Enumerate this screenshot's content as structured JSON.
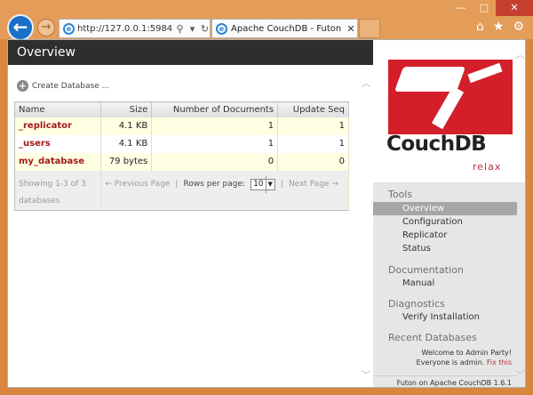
{
  "browser": {
    "address_text": "http://127.0.0.1:5984/_u",
    "tab_title": "Apache CouchDB - Futon: ...",
    "search_icon": "search-icon",
    "refresh_icon": "refresh-icon"
  },
  "page": {
    "header_title": "Overview",
    "create_db_label": "Create Database ...",
    "table": {
      "columns": [
        "Name",
        "Size",
        "Number of Documents",
        "Update Seq"
      ],
      "rows": [
        {
          "name": "_replicator",
          "size": "4.1 KB",
          "docs": "1",
          "seq": "1"
        },
        {
          "name": "_users",
          "size": "4.1 KB",
          "docs": "1",
          "seq": "1"
        },
        {
          "name": "my_database",
          "size": "79 bytes",
          "docs": "0",
          "seq": "0"
        }
      ],
      "footer": {
        "showing": "Showing 1-3 of 3 databases",
        "prev": "← Previous Page",
        "sep1": "|",
        "rows_label": "Rows per page:",
        "rows_value": "10",
        "sep2": "|",
        "next": "Next Page →"
      }
    }
  },
  "sidebar": {
    "logo_text": "CouchDB",
    "logo_tagline": "relax",
    "tools_title": "Tools",
    "tools": [
      "Overview",
      "Configuration",
      "Replicator",
      "Status"
    ],
    "documentation_title": "Documentation",
    "documentation": [
      "Manual"
    ],
    "diagnostics_title": "Diagnostics",
    "diagnostics": [
      "Verify Installation"
    ],
    "recent_title": "Recent Databases",
    "welcome_line1": "Welcome to Admin Party!",
    "welcome_line2": "Everyone is admin.",
    "fix_link": "Fix this",
    "version": "Futon on Apache CouchDB 1.6.1"
  }
}
